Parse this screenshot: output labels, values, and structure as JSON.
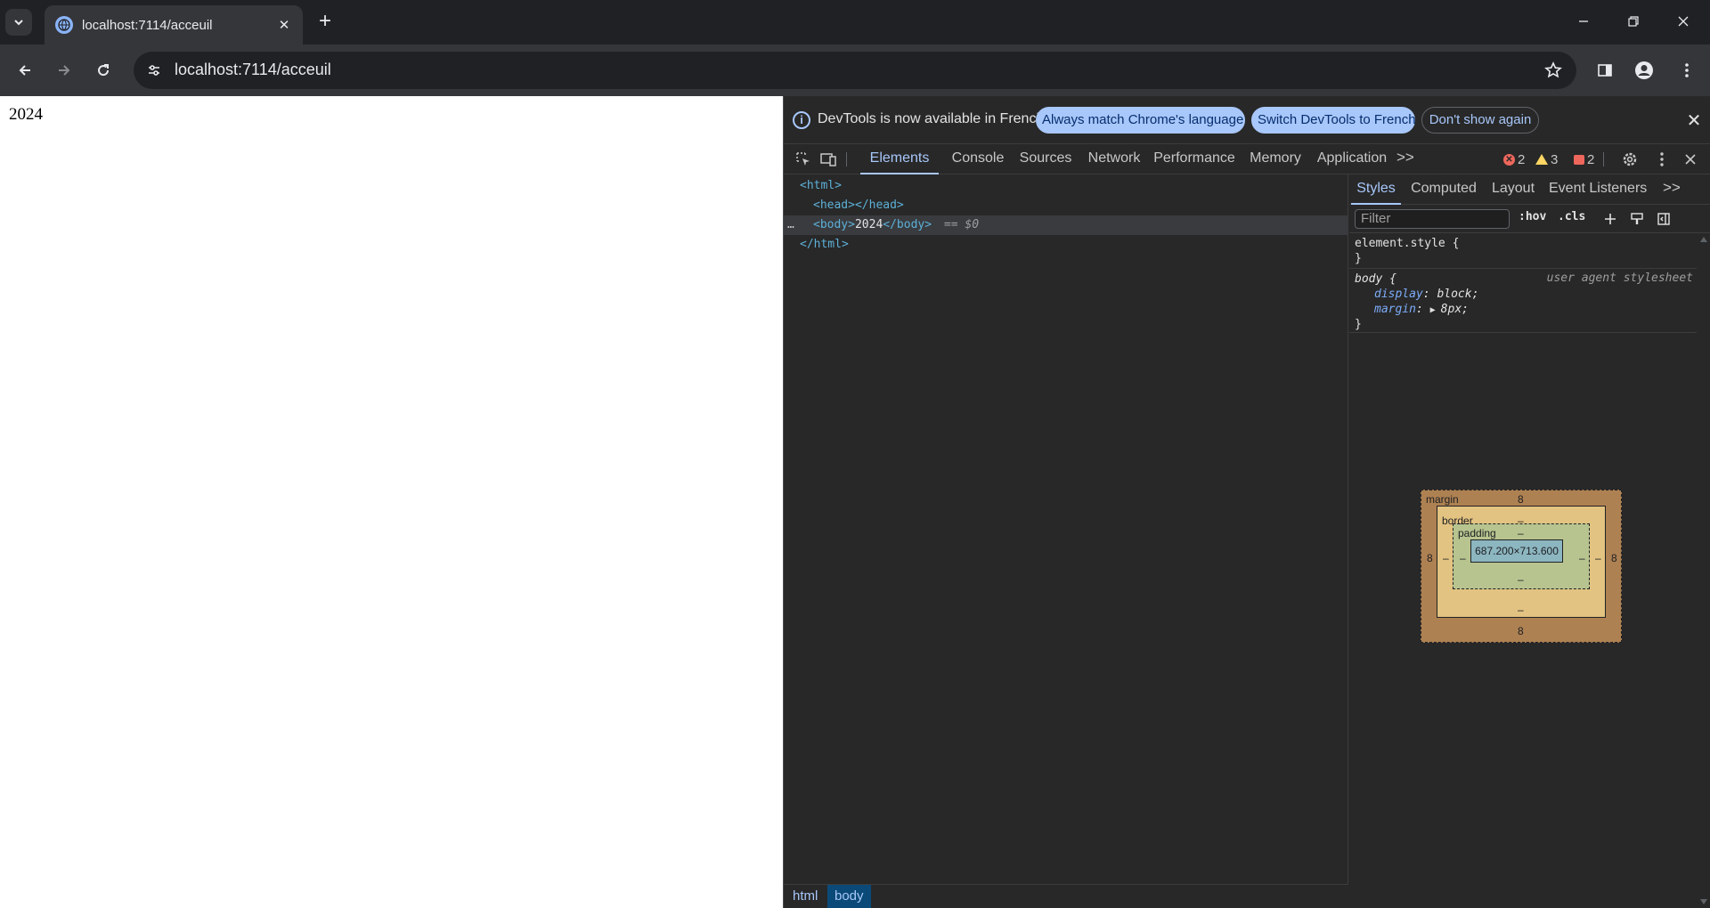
{
  "browser": {
    "tab_title": "localhost:7114/acceuil",
    "url": "localhost:7114/acceuil"
  },
  "page": {
    "body_text": "2024"
  },
  "devtools": {
    "infobar": {
      "message": "DevTools is now available in French!",
      "btn_match": "Always match Chrome's language",
      "btn_switch": "Switch DevTools to French",
      "btn_dismiss": "Don't show again"
    },
    "tabs": [
      "Elements",
      "Console",
      "Sources",
      "Network",
      "Performance",
      "Memory",
      "Application"
    ],
    "more_tabs": ">>",
    "counts": {
      "errors": "2",
      "warnings": "3",
      "issues": "2"
    },
    "dom": {
      "l1": "<html>",
      "l2": "<head></head>",
      "l3_open": "<body>",
      "l3_text": "2024",
      "l3_close": "</body>",
      "l3_ref": "== $0",
      "l4": "</html>",
      "dots": "…"
    },
    "breadcrumbs": [
      "html",
      "body"
    ],
    "styles": {
      "tabs": [
        "Styles",
        "Computed",
        "Layout",
        "Event Listeners"
      ],
      "more": ">>",
      "filter_placeholder": "Filter",
      "hov": ":hov",
      "cls": ".cls",
      "rule1_selector": "element.style {",
      "rule1_close": "}",
      "rule2_selector": "body {",
      "rule2_source": "user agent stylesheet",
      "rule2_p1_name": "display",
      "rule2_p1_val": "block;",
      "rule2_p2_name": "margin",
      "rule2_p2_val": "8px;",
      "rule2_close": "}"
    },
    "box_model": {
      "margin_label": "margin",
      "border_label": "border",
      "padding_label": "padding",
      "margin": {
        "top": "8",
        "right": "8",
        "bottom": "8",
        "left": "8"
      },
      "border": {
        "top": "–",
        "right": "–",
        "bottom": "–",
        "left": "–"
      },
      "padding": {
        "top": "–",
        "right": "–",
        "bottom": "–",
        "left": "–"
      },
      "content": "687.200×713.600"
    }
  }
}
